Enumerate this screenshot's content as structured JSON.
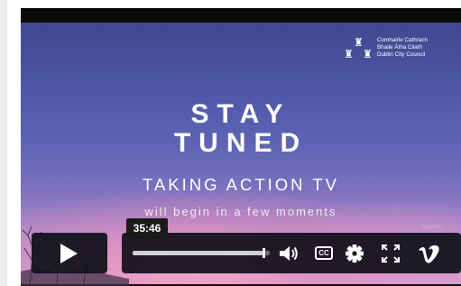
{
  "council": {
    "line1": "Comhairle Cathrach",
    "line2": "Bhaile Átha Cliath",
    "line3": "Dublin City Council"
  },
  "slate": {
    "line1": "STAY",
    "line2": "TUNED",
    "subtitle": "TAKING ACTION TV",
    "tagline": "will begin in a few moments"
  },
  "player": {
    "time_tooltip": "35:46",
    "progress": 0.95,
    "cc_label": "CC",
    "icons": [
      "play-icon",
      "volume-icon",
      "captions-icon",
      "settings-icon",
      "fullscreen-icon",
      "vimeo-logo"
    ]
  },
  "watermark": "TAKING"
}
